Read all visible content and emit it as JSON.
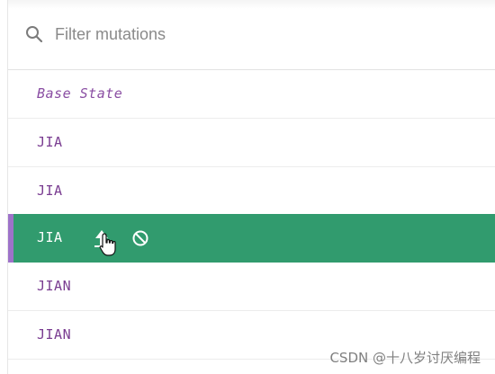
{
  "filter": {
    "placeholder": "Filter mutations",
    "value": ""
  },
  "rows": [
    {
      "label": "Base State",
      "kind": "base"
    },
    {
      "label": "JIA",
      "kind": "mutation"
    },
    {
      "label": "JIA",
      "kind": "mutation"
    },
    {
      "label": "JIA",
      "kind": "mutation",
      "selected": true,
      "actions": [
        "commit-icon",
        "revert-icon"
      ]
    },
    {
      "label": "JIAN",
      "kind": "mutation"
    },
    {
      "label": "JIAN",
      "kind": "mutation"
    }
  ],
  "colors": {
    "selected_background": "#319b6e",
    "selected_edge": "#9e72c9",
    "label_purple": "#7a3d91"
  },
  "watermark": "CSDN @十八岁讨厌编程"
}
